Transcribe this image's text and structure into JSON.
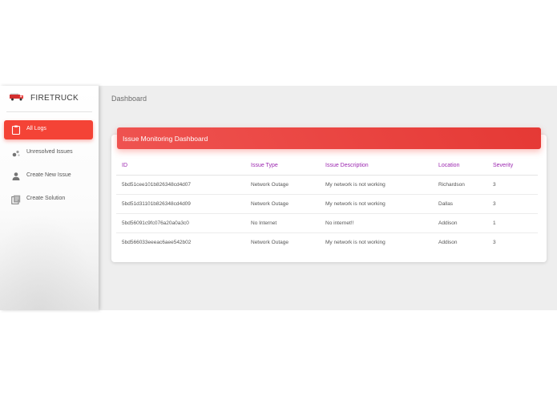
{
  "sidebar": {
    "brand": "FIRETRUCK",
    "items": [
      {
        "label": "All Logs",
        "icon": "clipboard-icon",
        "active": true
      },
      {
        "label": "Unresolved Issues",
        "icon": "bubbles-icon",
        "active": false
      },
      {
        "label": "Create New Issue",
        "icon": "person-icon",
        "active": false
      },
      {
        "label": "Create Solution",
        "icon": "library-books-icon",
        "active": false
      }
    ]
  },
  "header": {
    "title": "Dashboard"
  },
  "card": {
    "title": "Issue Monitoring Dashboard",
    "columns": [
      "ID",
      "Issue Type",
      "Issue Description",
      "Location",
      "Severity"
    ],
    "rows": [
      [
        "5bd51cee101b826348cd4d07",
        "Network Outage",
        "My network is not working",
        "Richardson",
        "3"
      ],
      [
        "5bd51d31101b826348cd4d09",
        "Network Outage",
        "My network is not working",
        "Dallas",
        "3"
      ],
      [
        "5bd56091c9fc076a20a0a3c0",
        "No Internet",
        "No internet!!",
        "Addison",
        "1"
      ],
      [
        "5bd566033eeeac6aee542b02",
        "Network Outage",
        "My network is not working",
        "Addison",
        "3"
      ]
    ]
  },
  "colors": {
    "accent": "#f44336",
    "header_text": "#9c27b0",
    "background": "#eeeeee"
  }
}
